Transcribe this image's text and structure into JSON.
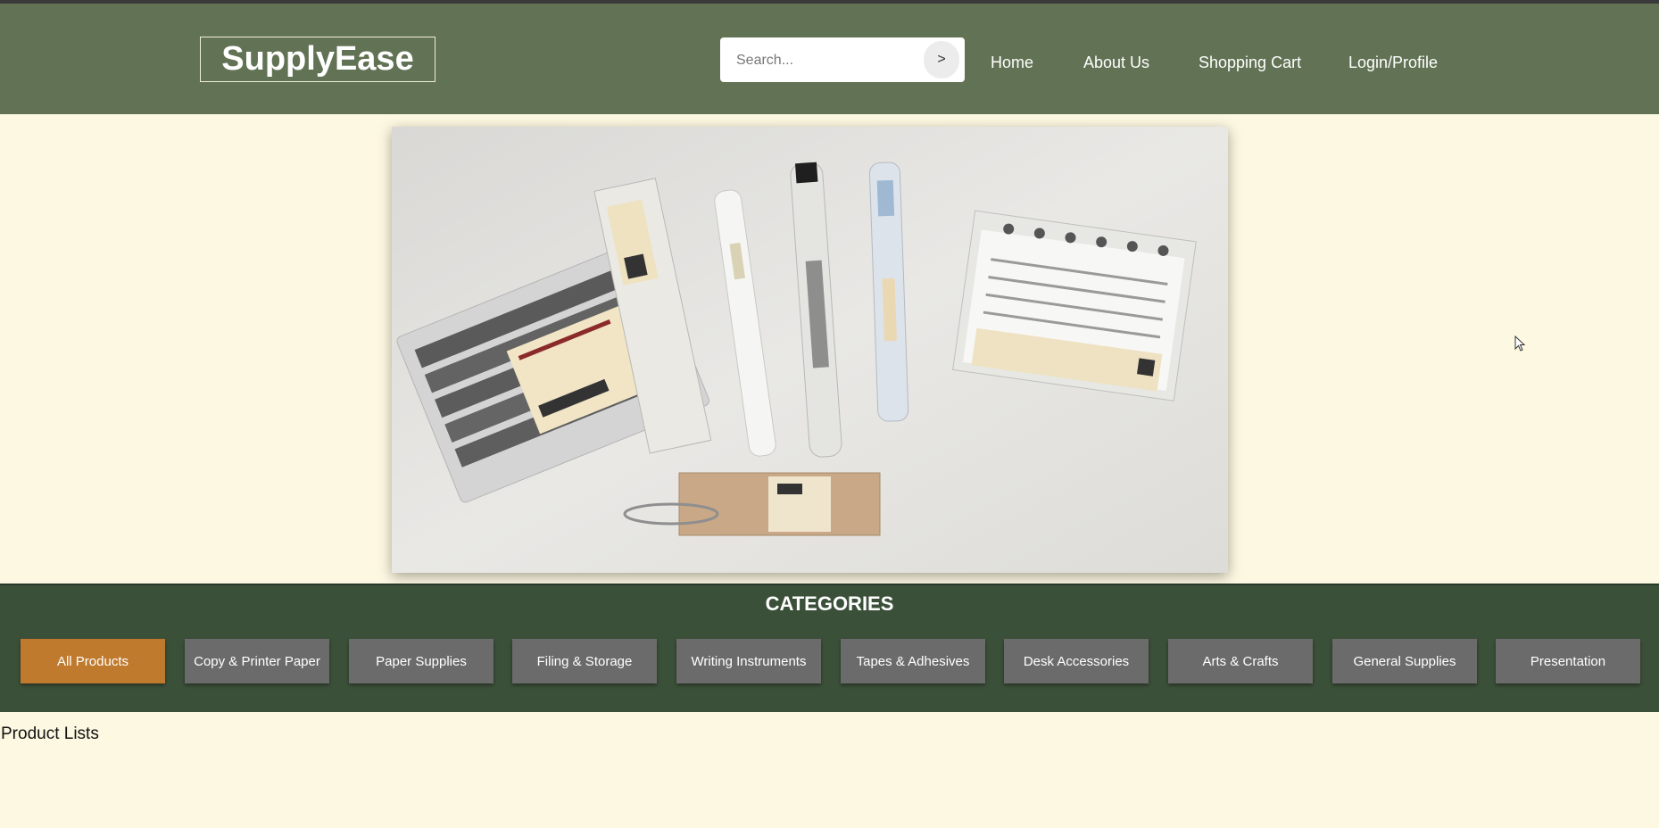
{
  "header": {
    "logo": "SupplyEase",
    "search": {
      "placeholder": "Search...",
      "button_label": ">"
    },
    "nav": [
      "Home",
      "About Us",
      "Shopping Cart",
      "Login/Profile"
    ]
  },
  "hero": {
    "image": "stationery-products-photo"
  },
  "categories": {
    "title": "CATEGORIES",
    "items": [
      "All Products",
      "Copy & Printer Paper",
      "Paper Supplies",
      "Filing & Storage",
      "Writing Instruments",
      "Tapes & Adhesives",
      "Desk Accessories",
      "Arts & Crafts",
      "General Supplies",
      "Presentation"
    ],
    "active": "All Products"
  },
  "main": {
    "section_label": "Product Lists"
  },
  "colors": {
    "header": "#627254",
    "page_bg": "#fdf8e1",
    "categories_bg": "#3b5039",
    "active_button": "#c07a2e",
    "button": "#6b6b6b"
  }
}
